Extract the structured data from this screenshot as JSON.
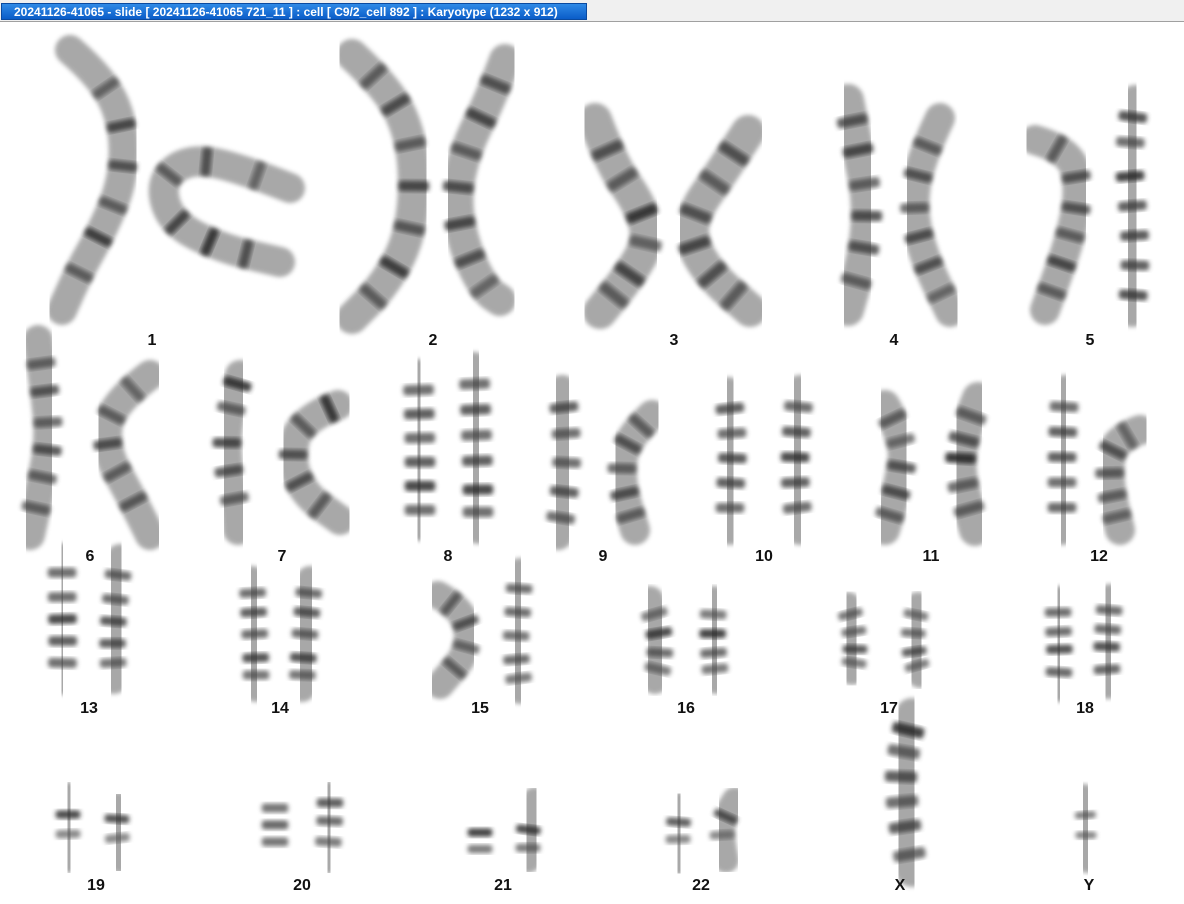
{
  "window": {
    "title": "20241126-41065 - slide [ 20241126-41065 721_11 ] : cell [ C9/2_cell 892 ] : Karyotype  (1232 x 912)"
  },
  "karyotype": {
    "labels": [
      "1",
      "2",
      "3",
      "4",
      "5",
      "6",
      "7",
      "8",
      "9",
      "10",
      "11",
      "12",
      "13",
      "14",
      "15",
      "16",
      "17",
      "18",
      "19",
      "20",
      "21",
      "22",
      "X",
      "Y"
    ]
  }
}
